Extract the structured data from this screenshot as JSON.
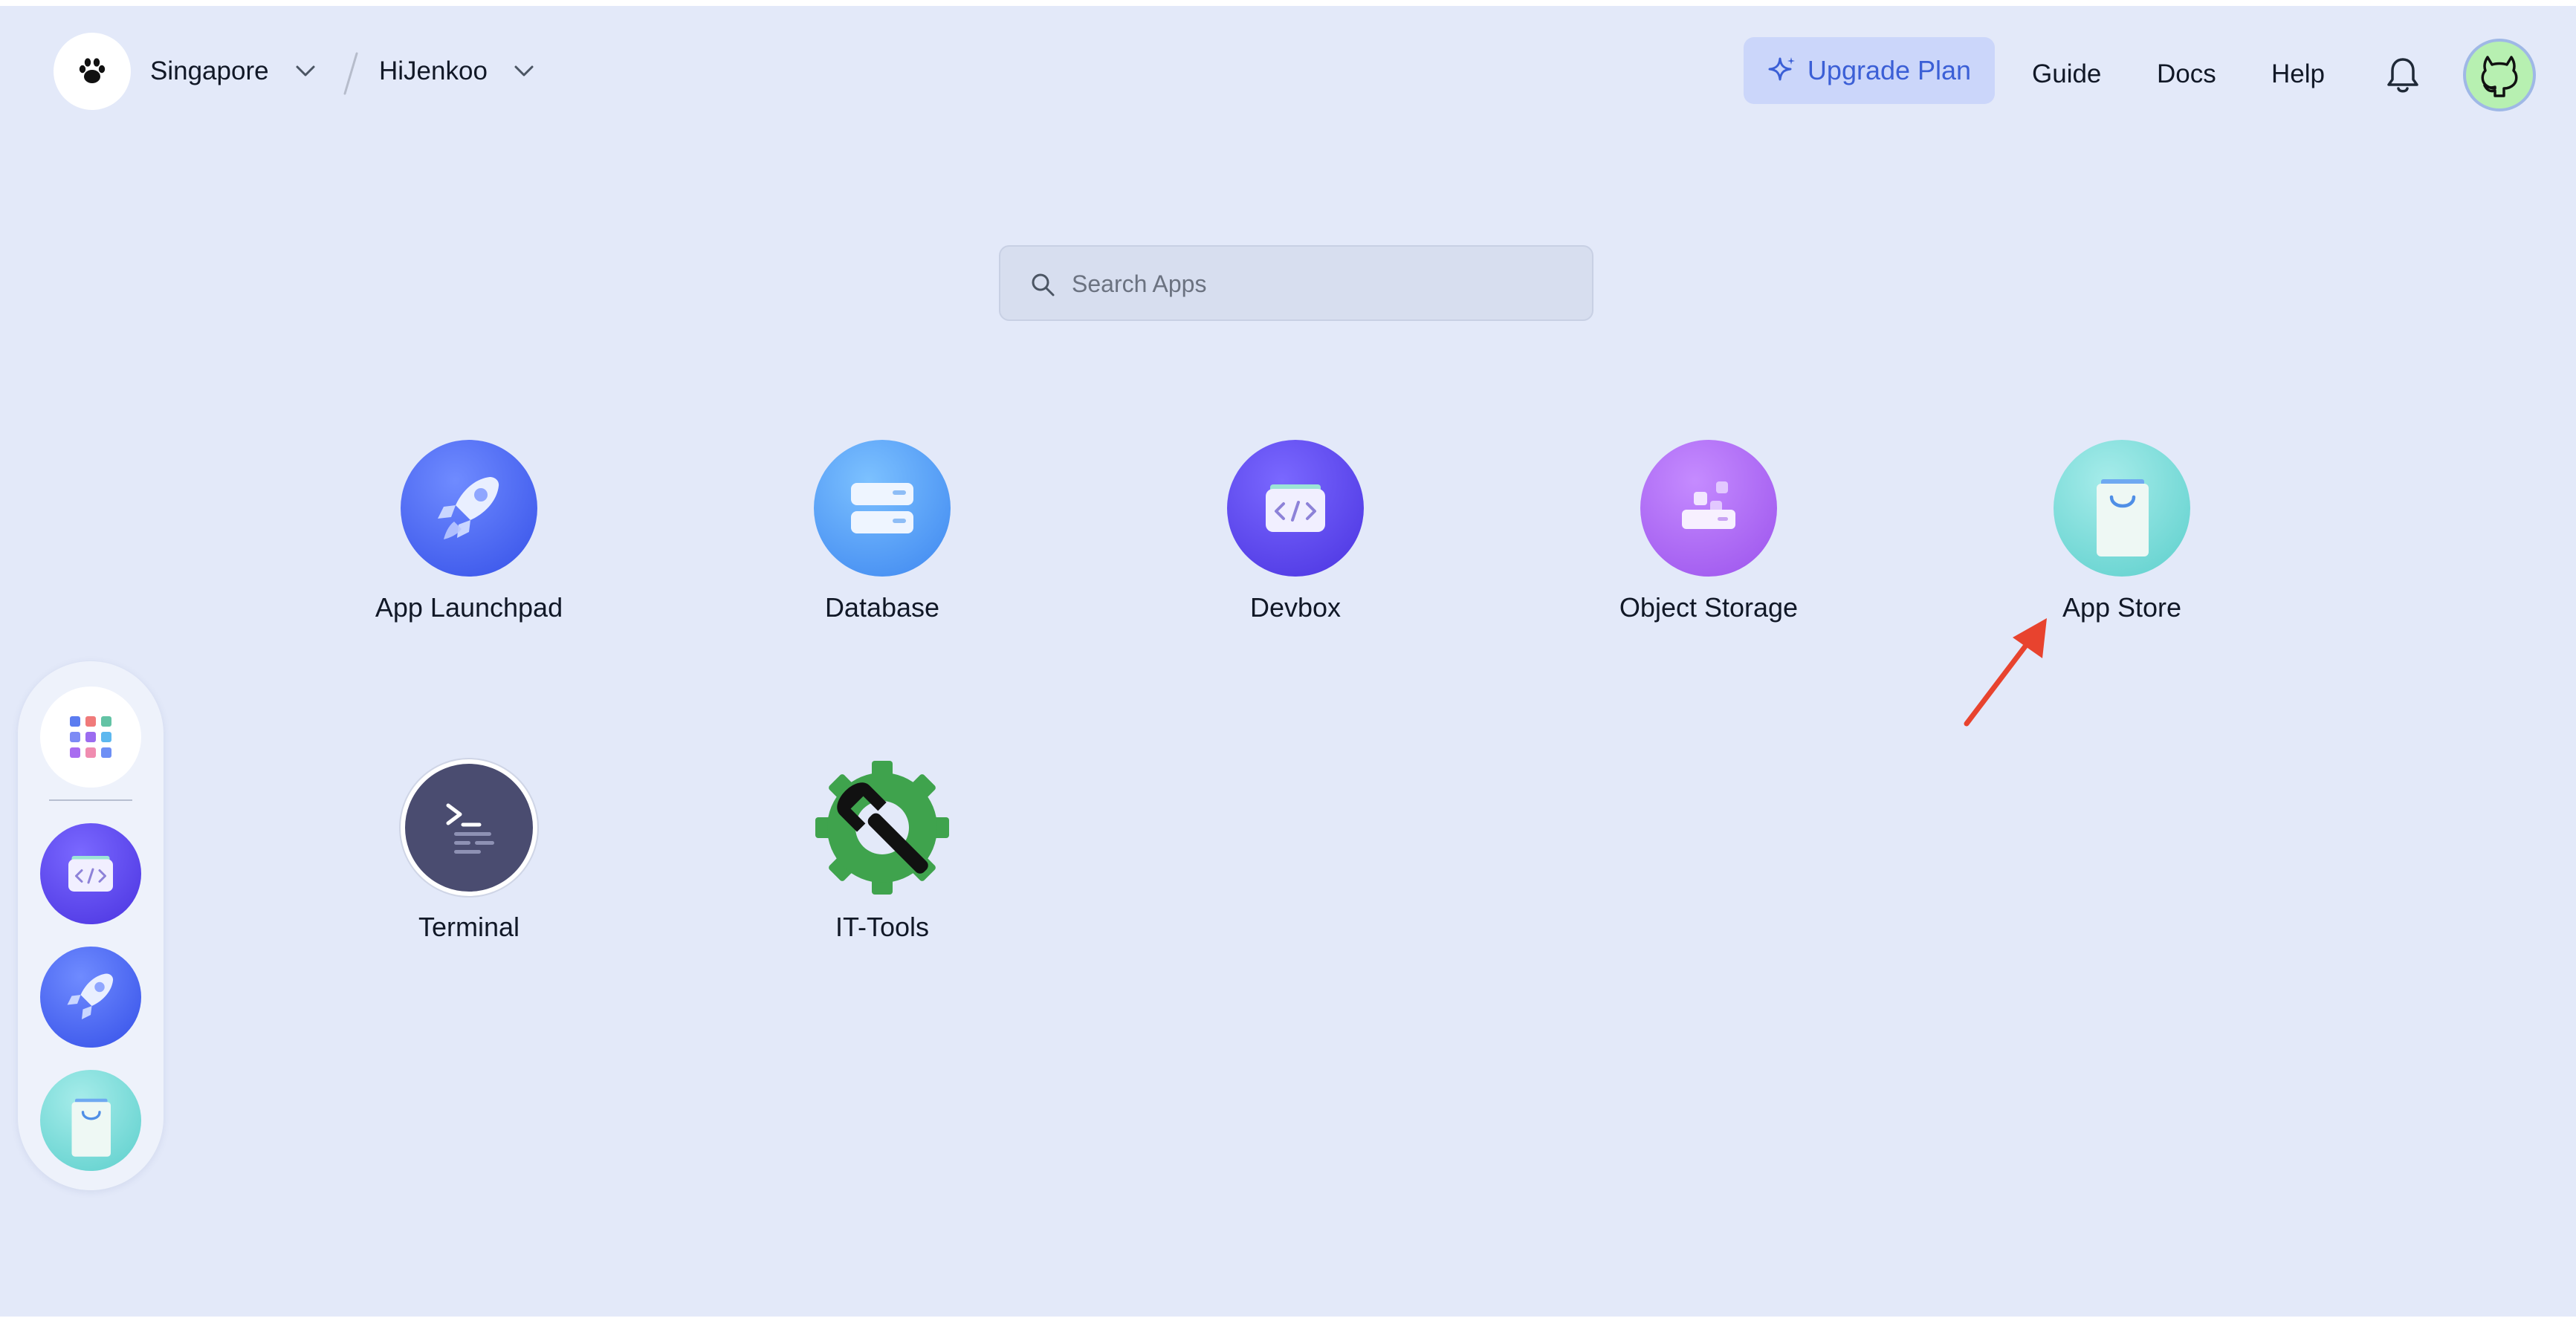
{
  "header": {
    "region": "Singapore",
    "workspace": "HiJenkoo",
    "upgrade_label": "Upgrade Plan",
    "nav": [
      "Guide",
      "Docs",
      "Help"
    ]
  },
  "search": {
    "placeholder": "Search Apps",
    "value": ""
  },
  "apps": [
    {
      "label": "App Launchpad",
      "icon": "rocket-icon"
    },
    {
      "label": "Database",
      "icon": "database-icon"
    },
    {
      "label": "Devbox",
      "icon": "devbox-code-icon"
    },
    {
      "label": "Object Storage",
      "icon": "object-storage-icon"
    },
    {
      "label": "App Store",
      "icon": "shopping-bag-icon"
    },
    {
      "label": "Terminal",
      "icon": "terminal-icon"
    },
    {
      "label": "IT-Tools",
      "icon": "wrench-gear-icon"
    }
  ],
  "dock": {
    "items": [
      "app-grid-icon",
      "devbox-code-icon",
      "rocket-icon",
      "shopping-bag-icon"
    ]
  },
  "colors": {
    "background": "#e3e9f9",
    "accent": "#3b5fd6",
    "upgrade_bg": "#cbd6fa",
    "annotation": "#e8432e"
  }
}
